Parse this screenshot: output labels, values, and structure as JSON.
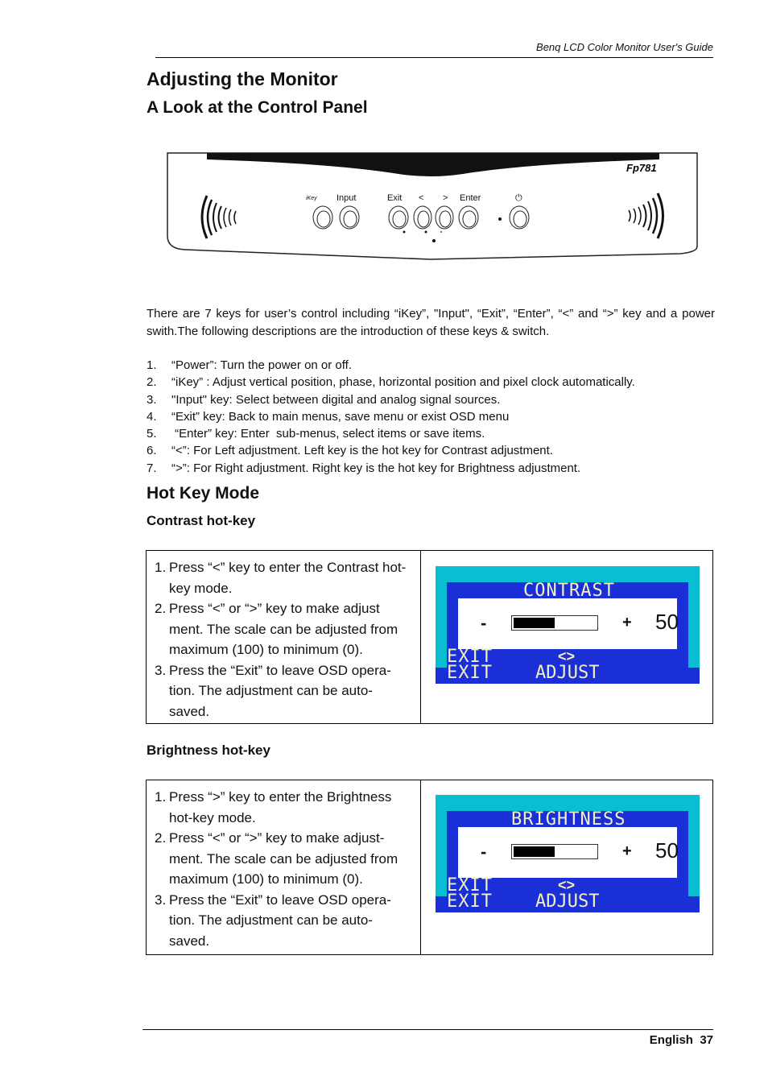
{
  "header": {
    "running_title": "Benq LCD Color Monitor User's Guide"
  },
  "title": "Adjusting the Monitor",
  "subtitle": "A Look at the Control Panel",
  "panel": {
    "model": "Fp781",
    "labels": [
      "iKey",
      "Input",
      "Exit",
      "<",
      ">",
      "Enter"
    ],
    "power_icon": "power-icon"
  },
  "intro": "There are 7 keys for user’s control including “iKey”, \"Input\", “Exit”, “Enter”, “<” and “>” key and a power swith.The  following  descriptions  are  the  introduction  of  these  keys  &   switch.",
  "keys": [
    {
      "n": "1.",
      "t": "“Power”: Turn the power on or off."
    },
    {
      "n": "2.",
      "t": "“iKey” : Adjust vertical position, phase, horizontal position and pixel clock automatically."
    },
    {
      "n": "3.",
      "t": "\"Input\" key: Select between digital and analog signal sources."
    },
    {
      "n": "4.",
      "t": "“Exit” key: Back to main menus,  save menu or exist OSD menu"
    },
    {
      "n": "5.",
      "t": " “Enter” key: Enter  sub-menus, select items or save items."
    },
    {
      "n": "6.",
      "t": "“<”: For Left adjustment. Left key is the hot key for Contrast adjustment."
    },
    {
      "n": "7.",
      "t": "“>”: For Right adjustment. Right key is the hot key for Brightness adjustment."
    }
  ],
  "hotkey_title": "Hot Key Mode",
  "contrast": {
    "heading": "Contrast hot-key",
    "steps": [
      {
        "n": "1.",
        "t": "Press “<” key to enter the Contrast hot-  key mode."
      },
      {
        "n": "2.",
        "t": "Press “<”  or  “>” key to make adjust ment. The scale can be adjusted from maximum (100) to minimum (0)."
      },
      {
        "n": "3.",
        "t": "Press the “Exit” to leave OSD opera- tion. The adjustment can be auto- saved."
      }
    ],
    "osd": {
      "title": "CONTRAST",
      "minus": "-",
      "plus": "+",
      "value": "50",
      "level_percent": 50,
      "exit": "EXIT",
      "arrows": "<>",
      "adjust": "ADJUST",
      "icon": "contrast-icon"
    }
  },
  "brightness": {
    "heading": "Brightness hot-key",
    "steps": [
      {
        "n": "1.",
        "t": "Press “>” key to enter the Brightness hot-key mode."
      },
      {
        "n": "2.",
        "t": "Press “<” or “>” key to make adjust- ment. The scale can be adjusted from maximum (100) to minimum (0)."
      },
      {
        "n": "3.",
        "t": "Press the “Exit” to leave OSD opera- tion. The adjustment can be auto- saved."
      }
    ],
    "osd": {
      "title": "BRIGHTNESS",
      "minus": "-",
      "plus": "+",
      "value": "50",
      "level_percent": 50,
      "exit": "EXIT",
      "arrows": "<>",
      "adjust": "ADJUST",
      "icon": "brightness-icon"
    }
  },
  "footer": {
    "language": "English",
    "page": "37"
  },
  "colors": {
    "osd_cyan": "#0abed2",
    "osd_blue": "#1a2fd6",
    "osd_text": "#f0f0c0"
  }
}
